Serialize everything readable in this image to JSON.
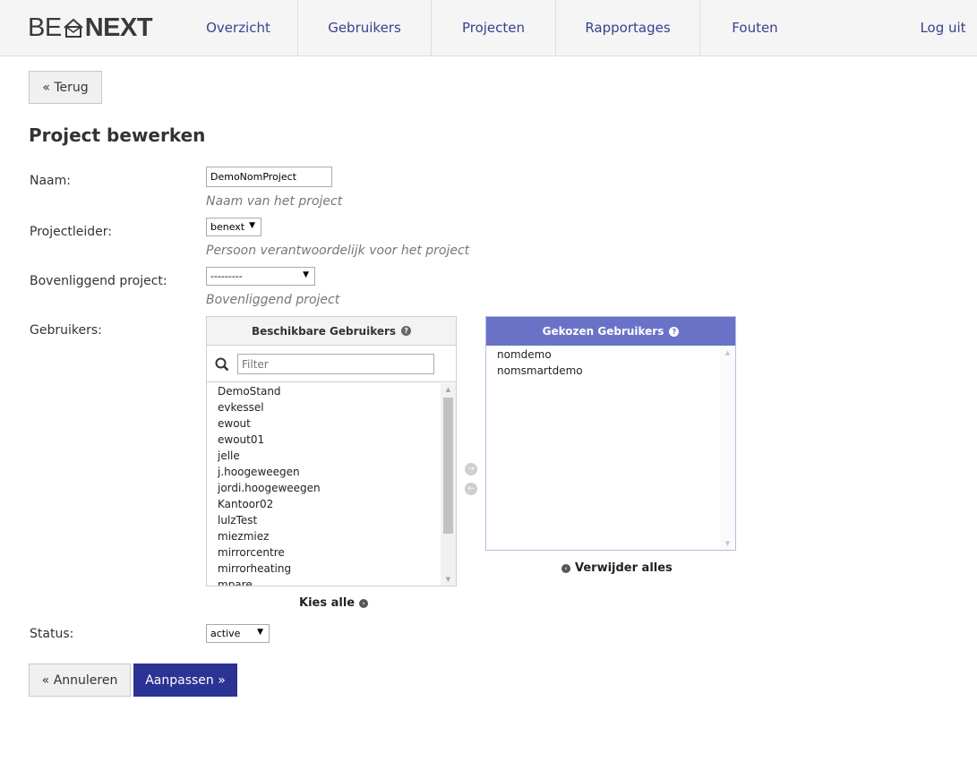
{
  "brand": {
    "logo_left": "BE",
    "logo_right": "NEXT"
  },
  "nav": {
    "items": [
      "Overzicht",
      "Gebruikers",
      "Projecten",
      "Rapportages",
      "Fouten"
    ],
    "logout": "Log uit"
  },
  "back_button": "« Terug",
  "page_title": "Project bewerken",
  "form": {
    "name_label": "Naam:",
    "name_value": "DemoNomProject",
    "name_help": "Naam van het project",
    "leader_label": "Projectleider:",
    "leader_value": "benext",
    "leader_help": "Persoon verantwoordelijk voor het project",
    "parent_label": "Bovenliggend project:",
    "parent_value": "---------",
    "parent_help": "Bovenliggend project",
    "users_label": "Gebruikers:",
    "status_label": "Status:",
    "status_value": "active"
  },
  "available": {
    "title": "Beschikbare Gebruikers",
    "filter_placeholder": "Filter",
    "users": [
      "DemoStand",
      "evkessel",
      "ewout",
      "ewout01",
      "jelle",
      "j.hoogeweegen",
      "jordi.hoogeweegen",
      "Kantoor02",
      "lulzTest",
      "miezmiez",
      "mirrorcentre",
      "mirrorheating",
      "mpare"
    ],
    "choose_all": "Kies alle"
  },
  "chosen": {
    "title": "Gekozen Gebruikers",
    "users": [
      "nomdemo",
      "nomsmartdemo"
    ],
    "remove_all": "Verwijder alles"
  },
  "actions": {
    "cancel": "« Annuleren",
    "submit": "Aanpassen »"
  },
  "colors": {
    "primary": "#2b3395",
    "chosen_header": "#6a72c8",
    "nav_text": "#3a3f8e"
  }
}
